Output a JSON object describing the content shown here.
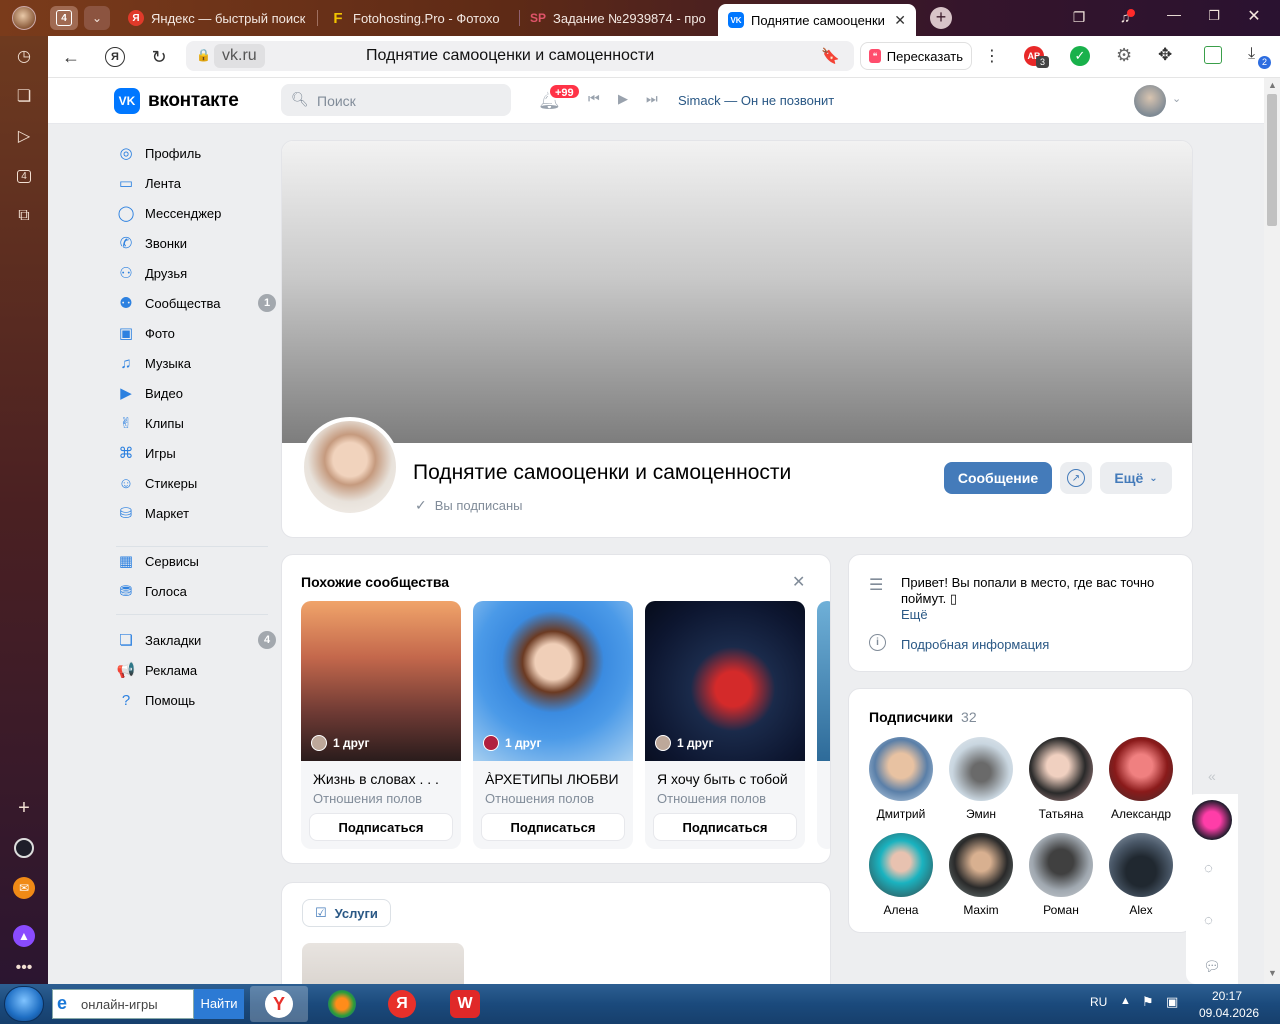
{
  "browser": {
    "tab_count": "4",
    "tabs": [
      {
        "title": "Яндекс — быстрый поиск",
        "icon": "Я"
      },
      {
        "title": "Fotohosting.Pro - Фотохо",
        "icon": "F"
      },
      {
        "title": "Задание №2939874 - про",
        "icon": "SP"
      },
      {
        "title": "Поднятие самооценки",
        "icon": "VK"
      }
    ],
    "domain": "vk.ru",
    "page_title": "Поднятие самооценки и самоценности",
    "retell_label": "Пересказать",
    "ext_badge_1": "3",
    "downloads_badge": "2",
    "rail_badge": "4"
  },
  "vk": {
    "logo_text": "вконтакте",
    "search_placeholder": "Поиск",
    "notif_badge": "+99",
    "now_playing": "Simack — Он не позвонит",
    "menu": [
      {
        "label": "Профиль",
        "icon": "profile-icon",
        "glyph": "◎"
      },
      {
        "label": "Лента",
        "icon": "feed-icon",
        "glyph": "▭"
      },
      {
        "label": "Мессенджер",
        "icon": "messenger-icon",
        "glyph": "◯"
      },
      {
        "label": "Звонки",
        "icon": "phone-icon",
        "glyph": "✆"
      },
      {
        "label": "Друзья",
        "icon": "friends-icon",
        "glyph": "⚇"
      },
      {
        "label": "Сообщества",
        "icon": "communities-icon",
        "glyph": "⚉",
        "badge": "1"
      },
      {
        "label": "Фото",
        "icon": "photo-icon",
        "glyph": "▣"
      },
      {
        "label": "Музыка",
        "icon": "music-icon",
        "glyph": "♫"
      },
      {
        "label": "Видео",
        "icon": "video-icon",
        "glyph": "▶"
      },
      {
        "label": "Клипы",
        "icon": "clips-icon",
        "glyph": "✌"
      },
      {
        "label": "Игры",
        "icon": "games-icon",
        "glyph": "⌘"
      },
      {
        "label": "Стикеры",
        "icon": "stickers-icon",
        "glyph": "☺"
      },
      {
        "label": "Маркет",
        "icon": "market-icon",
        "glyph": "⛁"
      }
    ],
    "menu2": [
      {
        "label": "Сервисы",
        "icon": "services-icon",
        "glyph": "▦"
      },
      {
        "label": "Голоса",
        "icon": "votes-icon",
        "glyph": "⛃"
      }
    ],
    "menu3": [
      {
        "label": "Закладки",
        "icon": "bookmarks-icon",
        "glyph": "❏",
        "badge": "4"
      },
      {
        "label": "Реклама",
        "icon": "ads-icon",
        "glyph": "📢"
      },
      {
        "label": "Помощь",
        "icon": "help-icon",
        "glyph": "?"
      }
    ],
    "group": {
      "name": "Поднятие самооценки и самоценности",
      "status": "Вы подписаны",
      "message_btn": "Сообщение",
      "more_btn": "Ещё"
    },
    "similar": {
      "title": "Похожие сообщества",
      "items": [
        {
          "friends": "1 друг",
          "name": "Жизнь в словах . . .",
          "category": "Отношения полов",
          "button": "Подписаться"
        },
        {
          "friends": "1 друг",
          "name": "ÀРХЕТИПЫ ЛЮБВИ",
          "category": "Отношения полов",
          "button": "Подписаться"
        },
        {
          "friends": "1 друг",
          "name": "Я хочу быть с тобой",
          "category": "Отношения полов",
          "button": "Подписаться"
        }
      ]
    },
    "about": {
      "text": "Привет! Вы попали в место, где вас точно поймут. ▯",
      "more": "Ещё",
      "details": "Подробная информация"
    },
    "subscribers": {
      "title": "Подписчики",
      "count": "32",
      "people": [
        "Дмитрий",
        "Эмин",
        "Татьяна",
        "Александр",
        "Алена",
        "Maxim",
        "Роман",
        "Alex"
      ]
    },
    "services_label": "Услуги"
  },
  "taskbar": {
    "search_text": "онлайн-игры",
    "search_button": "Найти",
    "lang": "RU",
    "time": "20:17",
    "date": "09.04.2026"
  }
}
